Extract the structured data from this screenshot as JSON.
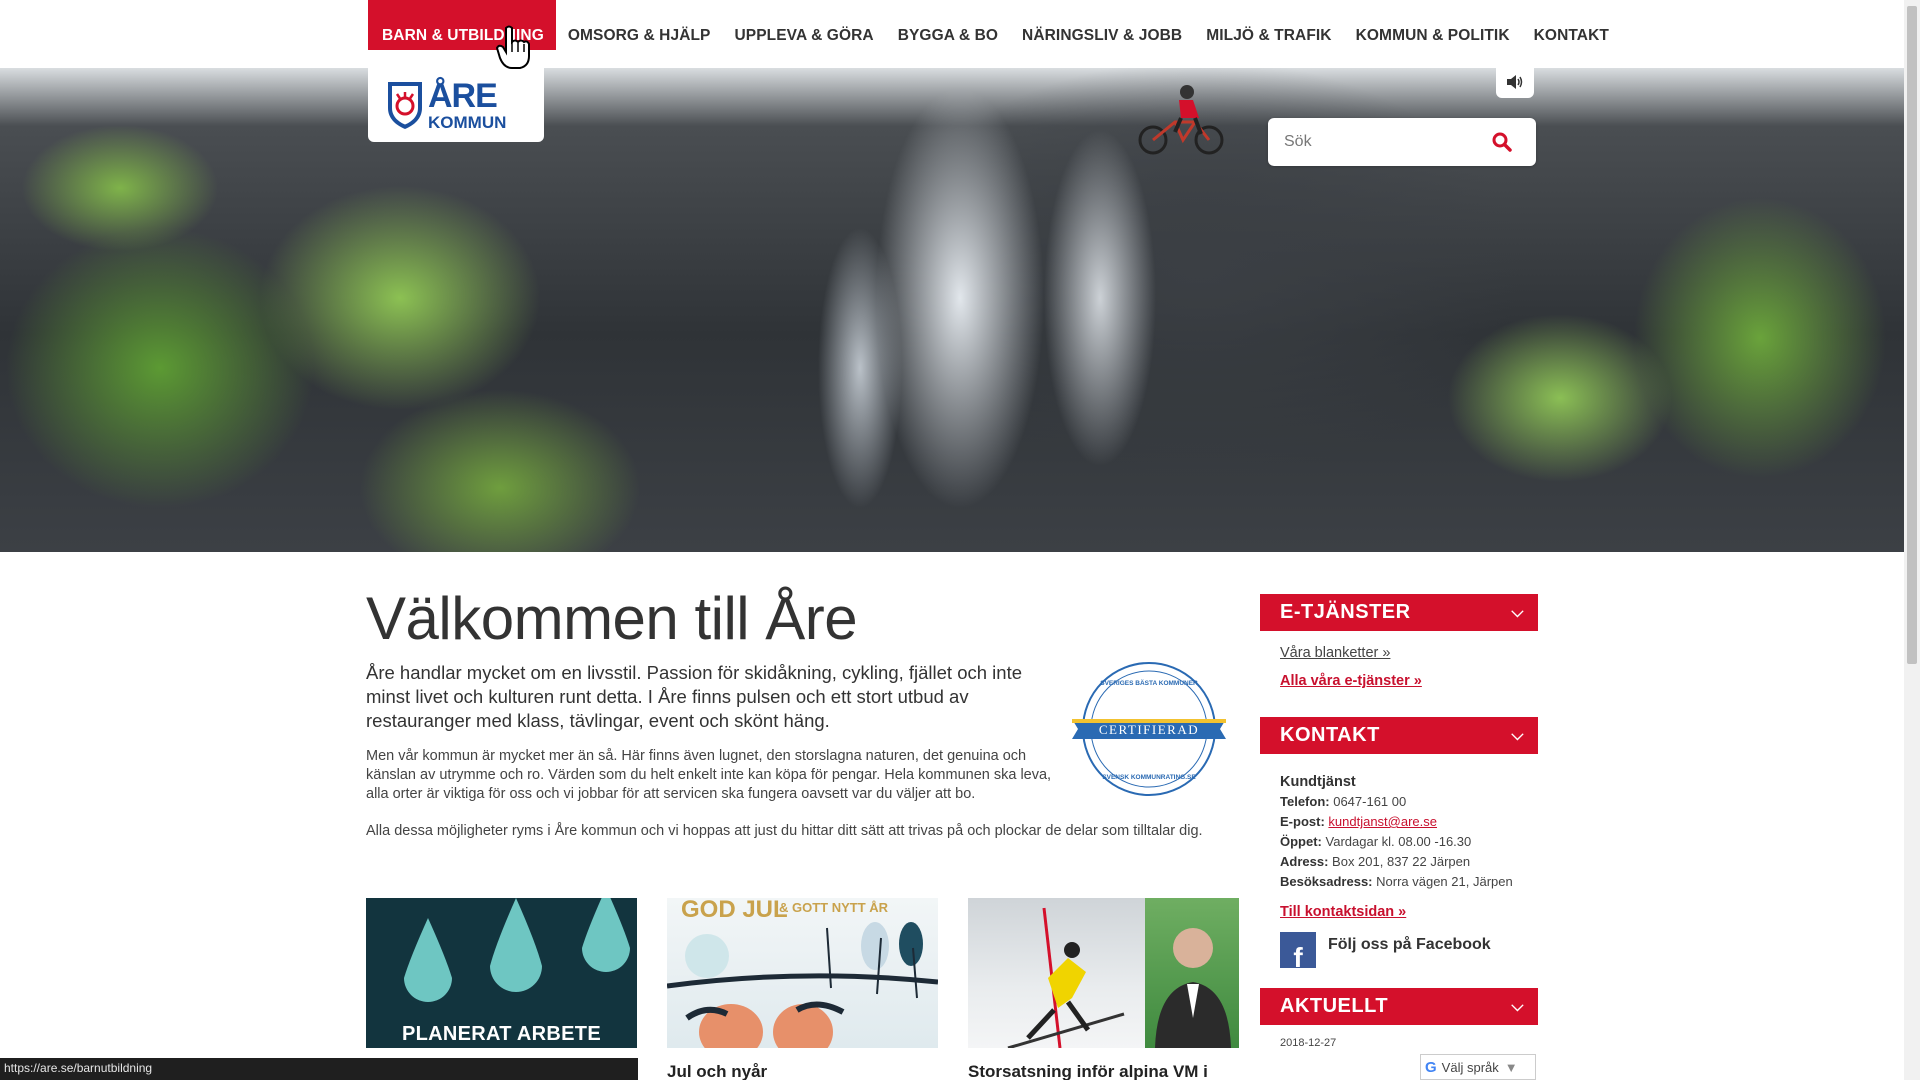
{
  "nav": {
    "items": [
      {
        "label": "BARN & UTBILDNING",
        "name": "nav-item-barn-utbildning",
        "active": true
      },
      {
        "label": "OMSORG & HJÄLP",
        "name": "nav-item-omsorg-hjalp"
      },
      {
        "label": "UPPLEVA & GÖRA",
        "name": "nav-item-uppleva-gora"
      },
      {
        "label": "BYGGA & BO",
        "name": "nav-item-bygga-bo"
      },
      {
        "label": "NÄRINGSLIV & JOBB",
        "name": "nav-item-naringsliv-jobb"
      },
      {
        "label": "MILJÖ & TRAFIK",
        "name": "nav-item-miljo-trafik"
      },
      {
        "label": "KOMMUN & POLITIK",
        "name": "nav-item-kommun-politik"
      },
      {
        "label": "KONTAKT",
        "name": "nav-item-kontakt"
      }
    ]
  },
  "logo": {
    "line1": "ÅRE",
    "line2": "KOMMUN"
  },
  "search": {
    "placeholder": "Sök"
  },
  "main": {
    "title": "Välkommen till Åre",
    "lead": "Åre handlar mycket om en livsstil. Passion för skidåkning, cykling, fjället och inte minst livet och kulturen runt detta. I Åre finns pulsen och ett stort utbud av restauranger med klass, tävlingar, event och skönt häng.",
    "para1": "Men vår kommun är mycket mer än så. Här finns även lugnet, den storslagna naturen, det genuina och känslan av utrymme och ro. Värden som du helt enkelt inte kan köpa för pengar. Hela kommunen ska leva, alla orter är viktiga för oss och vi jobbar för att servicen ska fungera oavsett var du väljer att bo.",
    "para2": "Alla dessa möjligheter ryms i Åre kommun och vi hoppas att just du hittar ditt sätt att trivas på och plockar de delar som tilltalar dig."
  },
  "badge": {
    "top": "SVERIGES BÄSTA KOMMUNER",
    "center": "CERTIFIERAD",
    "bottom": "SVENSK KOMMUNRATING.SE"
  },
  "cards": [
    {
      "image_text": "PLANERAT ARBETE",
      "title": ""
    },
    {
      "image_text": "GOD JUL",
      "image_text2": "& GOTT NYTT ÅR",
      "title": "Jul och nyår"
    },
    {
      "title": "Storsatsning inför alpina VM i"
    }
  ],
  "sidebar": {
    "etjanster": {
      "heading": "E-TJÄNSTER",
      "link1": "Våra blanketter »",
      "link2": "Alla våra e-tjänster »"
    },
    "kontakt": {
      "heading": "KONTAKT",
      "name": "Kundtjänst",
      "phone_label": "Telefon:",
      "phone": "0647-161 00",
      "email_label": "E-post:",
      "email": "kundtjanst@are.se",
      "open_label": "Öppet:",
      "open": "Vardagar kl. 08.00 -16.30",
      "address_label": "Adress:",
      "address": "Box 201, 837 22 Järpen",
      "visit_label": "Besöksadress:",
      "visit": "Norra vägen 21, Järpen",
      "contact_link": "Till kontaktsidan »",
      "facebook": "Följ oss på Facebook"
    },
    "aktuellt": {
      "heading": "AKTUELLT",
      "date": "2018-12-27"
    }
  },
  "language": {
    "label": "Välj språk",
    "g": "G",
    "caret": "▼"
  },
  "statusbar": {
    "url": "https://are.se/barnutbildning"
  },
  "colors": {
    "brand_red": "#d4102b",
    "brand_blue": "#1b4f9e",
    "facebook_blue": "#3b5998"
  },
  "icons": {
    "sound": "speaker-icon",
    "search": "search-icon",
    "chevron": "chevron-down-icon",
    "facebook": "facebook-icon",
    "cursor": "hand-cursor-icon"
  }
}
